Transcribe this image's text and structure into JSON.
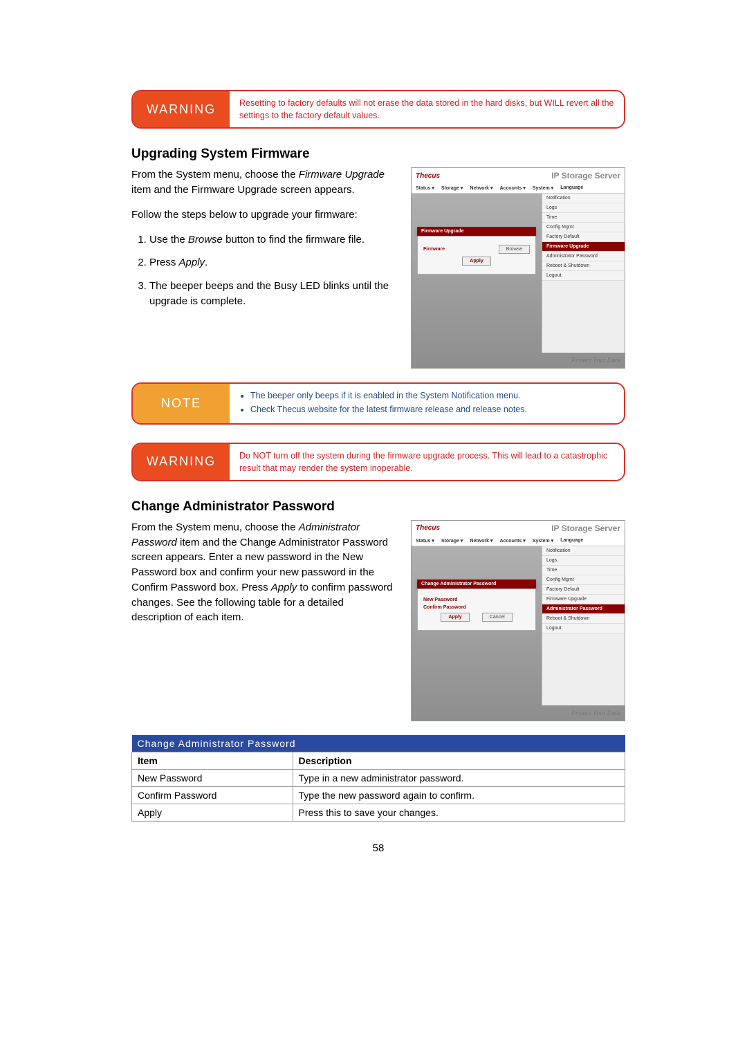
{
  "warning1": {
    "label": "WARNING",
    "text": "Resetting to factory defaults will not erase the data stored in the hard disks, but WILL revert all the settings to the factory default values."
  },
  "section1": {
    "heading": "Upgrading System Firmware",
    "p1_a": "From the System menu, choose the ",
    "p1_i": "Firmware Upgrade",
    "p1_b": " item and the Firmware Upgrade screen appears.",
    "p2": "Follow the steps below to upgrade your firmware:",
    "li1_a": "Use the ",
    "li1_i": "Browse",
    "li1_b": " button to find the firmware file.",
    "li2_a": "Press ",
    "li2_i": "Apply",
    "li2_b": ".",
    "li3": "The beeper beeps and the Busy LED blinks until the upgrade is complete."
  },
  "note1": {
    "label": "NOTE",
    "b1": "The beeper only beeps if it is enabled in the System Notification menu.",
    "b2": "Check Thecus website for the latest firmware release and release notes."
  },
  "warning2": {
    "label": "WARNING",
    "text": "Do NOT turn off the system during the firmware upgrade process. This will lead to a catastrophic result that may render the system inoperable."
  },
  "section2": {
    "heading": "Change Administrator Password",
    "p1_a": "From the System menu, choose the ",
    "p1_i": "Administrator Password",
    "p1_b": " item and the Change Administrator Password screen appears. Enter a new password in the New Password box and confirm your new password in the Confirm Password box. Press ",
    "p1_i2": "Apply",
    "p1_c": " to confirm password changes. See the following table for a detailed description of each item."
  },
  "shot_common": {
    "logo": "Thecus",
    "title": "IP Storage Server",
    "menu": [
      "Status ▾",
      "Storage ▾",
      "Network ▾",
      "Accounts ▾",
      "System ▾",
      "Language"
    ],
    "side": [
      "Notification",
      "Logs",
      "Time",
      "Config Mgmt",
      "Factory Default",
      "Firmware Upgrade",
      "Administrator Password",
      "Reboot & Shutdown",
      "Logout"
    ],
    "footer": "Protect Your Data"
  },
  "shot1": {
    "panel_title": "Firmware Upgrade",
    "field": "Firmware",
    "browse": "Browse",
    "apply": "Apply",
    "current_idx": 5
  },
  "shot2": {
    "panel_title": "Change Administrator Password",
    "f1": "New Password",
    "f2": "Confirm Password",
    "apply": "Apply",
    "cancel": "Cancel",
    "current_idx": 6
  },
  "table": {
    "caption": "Change Administrator Password",
    "h1": "Item",
    "h2": "Description",
    "rows": [
      [
        "New Password",
        "Type in a new administrator password."
      ],
      [
        "Confirm Password",
        "Type the new password again to confirm."
      ],
      [
        "Apply",
        "Press this to save your changes."
      ]
    ]
  },
  "page_number": "58"
}
